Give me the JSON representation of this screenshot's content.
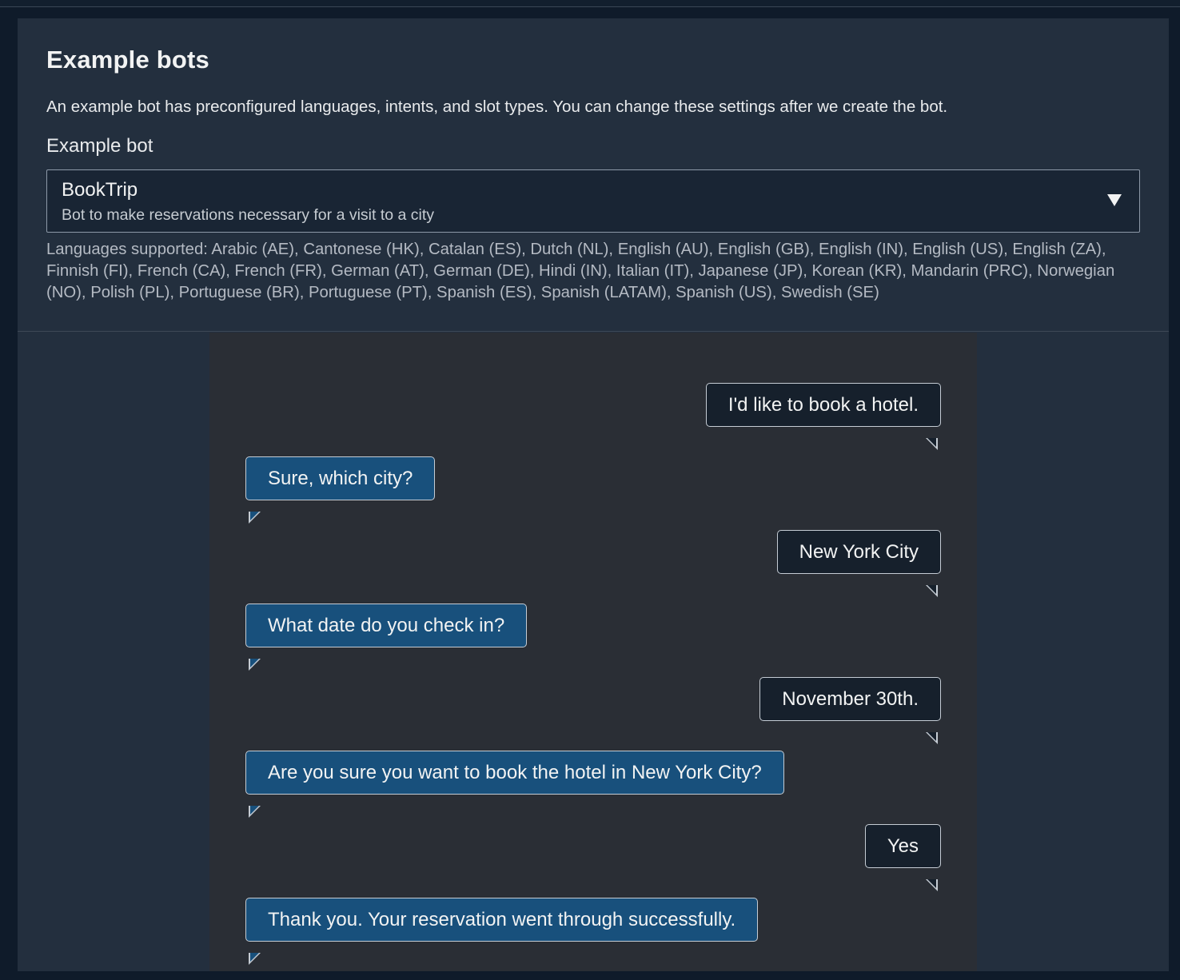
{
  "section": {
    "title": "Example bots",
    "description": "An example bot has preconfigured languages, intents, and slot types. You can change these settings after we create the bot."
  },
  "example_bot_field": {
    "label": "Example bot",
    "selected_value": "BookTrip",
    "selected_description": "Bot to make reservations necessary for a visit to a city",
    "dropdown_icon": "caret-down-icon"
  },
  "languages_supported": "Languages supported: Arabic (AE), Cantonese (HK), Catalan (ES), Dutch (NL), English (AU), English (GB), English (IN), English (US), English (ZA), Finnish (FI), French (CA), French (FR), German (AT), German (DE), Hindi (IN), Italian (IT), Japanese (JP), Korean (KR), Mandarin (PRC), Norwegian (NO), Polish (PL), Portuguese (BR), Portuguese (PT), Spanish (ES), Spanish (LATAM), Spanish (US), Swedish (SE)",
  "conversation": [
    {
      "speaker": "user",
      "text": "I'd like to book a hotel."
    },
    {
      "speaker": "bot",
      "text": "Sure, which city?"
    },
    {
      "speaker": "user",
      "text": "New York City"
    },
    {
      "speaker": "bot",
      "text": "What date do you check in?"
    },
    {
      "speaker": "user",
      "text": "November 30th."
    },
    {
      "speaker": "bot",
      "text": "Are you sure you want to book the hotel in New York City?"
    },
    {
      "speaker": "user",
      "text": "Yes"
    },
    {
      "speaker": "bot",
      "text": "Thank you. Your reservation went through successfully."
    }
  ],
  "colors": {
    "page_background": "#0f1b2a",
    "panel_background": "#232f3e",
    "chat_background": "#2a2e35",
    "user_bubble": "#16202c",
    "bot_bubble": "#18507c",
    "bubble_border": "#c5ccd4"
  }
}
